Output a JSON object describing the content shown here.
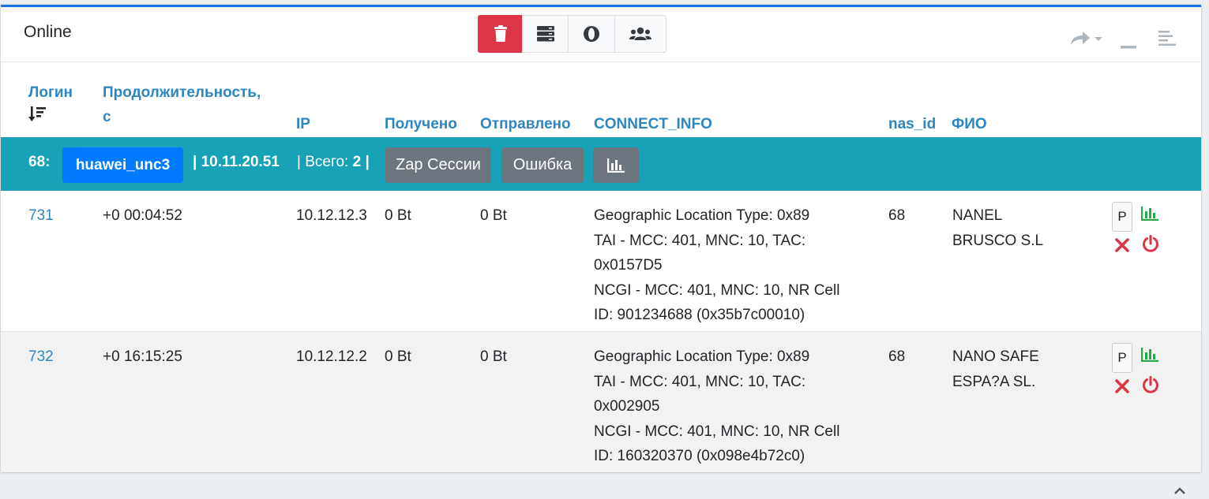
{
  "header": {
    "title": "Online",
    "toolbar_icons": [
      "trash-icon",
      "server-icon",
      "opera-icon",
      "users-icon"
    ],
    "tool_icons": [
      "share-icon",
      "minimize-icon",
      "menu-lines-icon"
    ]
  },
  "table": {
    "columns": {
      "login": "Логин",
      "duration_l1": "Продолжительность,",
      "duration_l2": "с",
      "ip": "IP",
      "received": "Получено",
      "sent": "Отправлено",
      "connect_info": "CONNECT_INFO",
      "nas_id": "nas_id",
      "fio": "ФИО"
    },
    "group": {
      "num": "68:",
      "nas_name": "huawei_unc3",
      "ip": "| 10.11.20.51",
      "total_label": "| Всего:",
      "total_value": "2",
      "total_suffix": "|",
      "zap_label": "Zap Сессии",
      "error_label": "Ошибка"
    },
    "rows": [
      {
        "login": "731",
        "duration": "+0 00:04:52",
        "ip": "10.12.12.3",
        "received": "0 Bt",
        "sent": "0 Bt",
        "ci1": "Geographic Location Type: 0x89",
        "ci2": "TAI - MCC: 401, MNC: 10, TAC:",
        "ci3": "0x0157D5",
        "ci4": "NCGI - MCC: 401, MNC: 10, NR Cell",
        "ci5": "ID: 901234688 (0x35b7c00010)",
        "nas_id": "68",
        "fio1": "NANEL",
        "fio2": "BRUSCO S.L",
        "p_label": "P"
      },
      {
        "login": "732",
        "duration": "+0 16:15:25",
        "ip": "10.12.12.2",
        "received": "0 Bt",
        "sent": "0 Bt",
        "ci1": "Geographic Location Type: 0x89",
        "ci2": "TAI - MCC: 401, MNC: 10, TAC:",
        "ci3": "0x002905",
        "ci4": "NCGI - MCC: 401, MNC: 10, NR Cell",
        "ci5": "ID: 160320370 (0x098e4b72c0)",
        "nas_id": "68",
        "fio1": "NANO SAFE",
        "fio2": "ESPA?A SL.",
        "p_label": "P"
      }
    ]
  },
  "colors": {
    "accent": "#1a73e8",
    "group_bg": "#17a2b8",
    "badge_bg": "#007bff",
    "danger": "#dc3545",
    "secondary": "#6c757d",
    "link": "#2e86c1",
    "success": "#28a745"
  }
}
